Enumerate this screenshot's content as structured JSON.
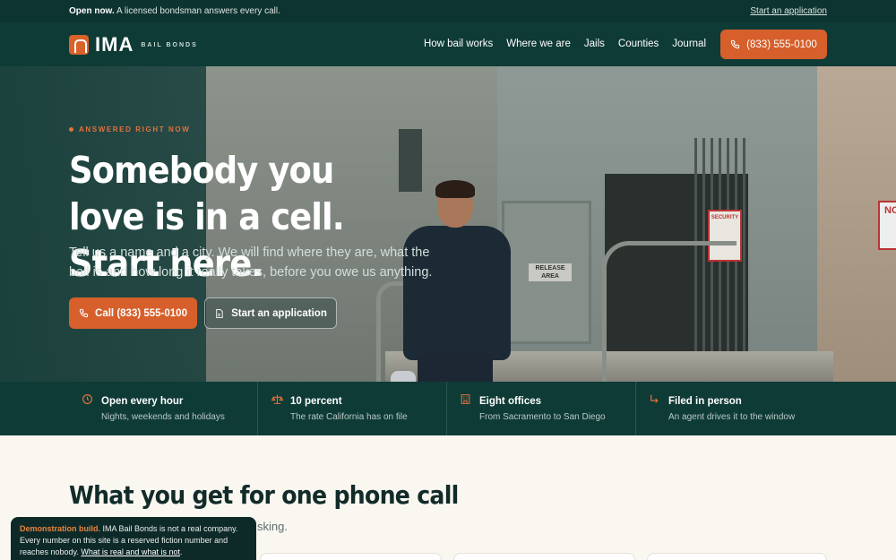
{
  "topbar": {
    "status_strong": "Open now.",
    "status_text": "A licensed bondsman answers every call.",
    "apply_link": "Start an application"
  },
  "brand": {
    "name": "IMA",
    "tagline": "BAIL BONDS"
  },
  "nav": {
    "links": [
      "How bail works",
      "Where we are",
      "Jails",
      "Counties",
      "Journal"
    ],
    "call_label": "(833) 555-0100"
  },
  "hero": {
    "eyebrow": "ANSWERED RIGHT NOW",
    "title": "Somebody you love is in a cell. Start here.",
    "subtitle": "Tell us a name and a city. We will find where they are, what the bail is and how long it really takes, before you owe us anything.",
    "cta_primary": "Call (833) 555-0100",
    "cta_secondary": "Start an application",
    "photo_signs": {
      "release": "RELEASE AREA",
      "security": "SECURITY",
      "no": "NO"
    }
  },
  "features": [
    {
      "icon": "clock-icon",
      "title": "Open every hour",
      "desc": "Nights, weekends and holidays"
    },
    {
      "icon": "scale-icon",
      "title": "10 percent",
      "desc": "The rate California has on file"
    },
    {
      "icon": "building-icon",
      "title": "Eight offices",
      "desc": "From Sacramento to San Diego"
    },
    {
      "icon": "arrow-turn-icon",
      "title": "Filed in person",
      "desc": "An agent drives it to the window"
    }
  ],
  "section": {
    "title": "What you get for one phone call",
    "subtitle_visible": "sking."
  },
  "demo_notice": {
    "label": "Demonstration build.",
    "text": "IMA Bail Bonds is not a real company. Every number on this site is a reserved fiction number and reaches nobody.",
    "link": "What is real and what is not"
  },
  "colors": {
    "accent": "#d65f2b",
    "nav_bg": "#0f3b37",
    "page_bg": "#faf7f1"
  }
}
